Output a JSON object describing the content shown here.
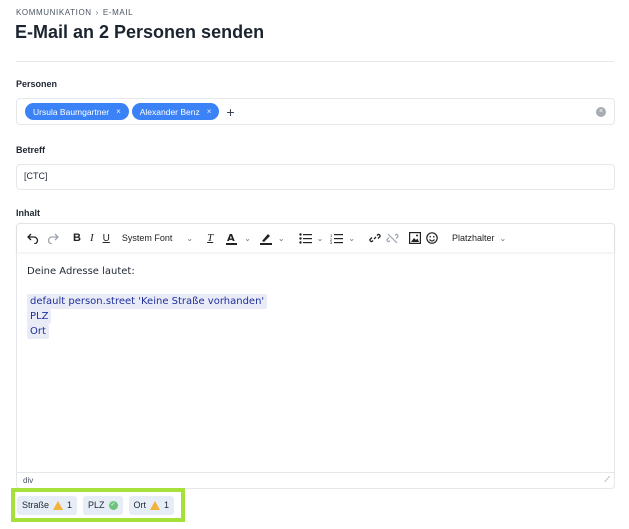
{
  "breadcrumb": {
    "section": "KOMMUNIKATION",
    "separator": "›",
    "current": "E-MAIL"
  },
  "title": "E-Mail an 2 Personen senden",
  "persons": {
    "label": "Personen",
    "chips": [
      {
        "name": "Ursula Baumgartner",
        "remove": "×"
      },
      {
        "name": "Alexander Benz",
        "remove": "×"
      }
    ],
    "add": "+",
    "clear": "×"
  },
  "subject": {
    "label": "Betreff",
    "value": "[CTC]"
  },
  "content": {
    "label": "Inhalt",
    "toolbar": {
      "font": "System Font",
      "placeholder_menu": "Platzhalter"
    },
    "lines": {
      "intro": "Deine Adresse lautet:",
      "street": "default person.street 'Keine Straße vorhanden'",
      "zip": "PLZ",
      "city": "Ort"
    },
    "status_path": "div"
  },
  "validation": [
    {
      "label": "Straße",
      "status": "warning",
      "count": "1"
    },
    {
      "label": "PLZ",
      "status": "ok",
      "count": ""
    },
    {
      "label": "Ort",
      "status": "warning",
      "count": "1"
    }
  ],
  "colors": {
    "chip": "#3b82f6",
    "highlight_border": "#a6e03a",
    "warning": "#f3b23a",
    "ok": "#6cc47a"
  }
}
